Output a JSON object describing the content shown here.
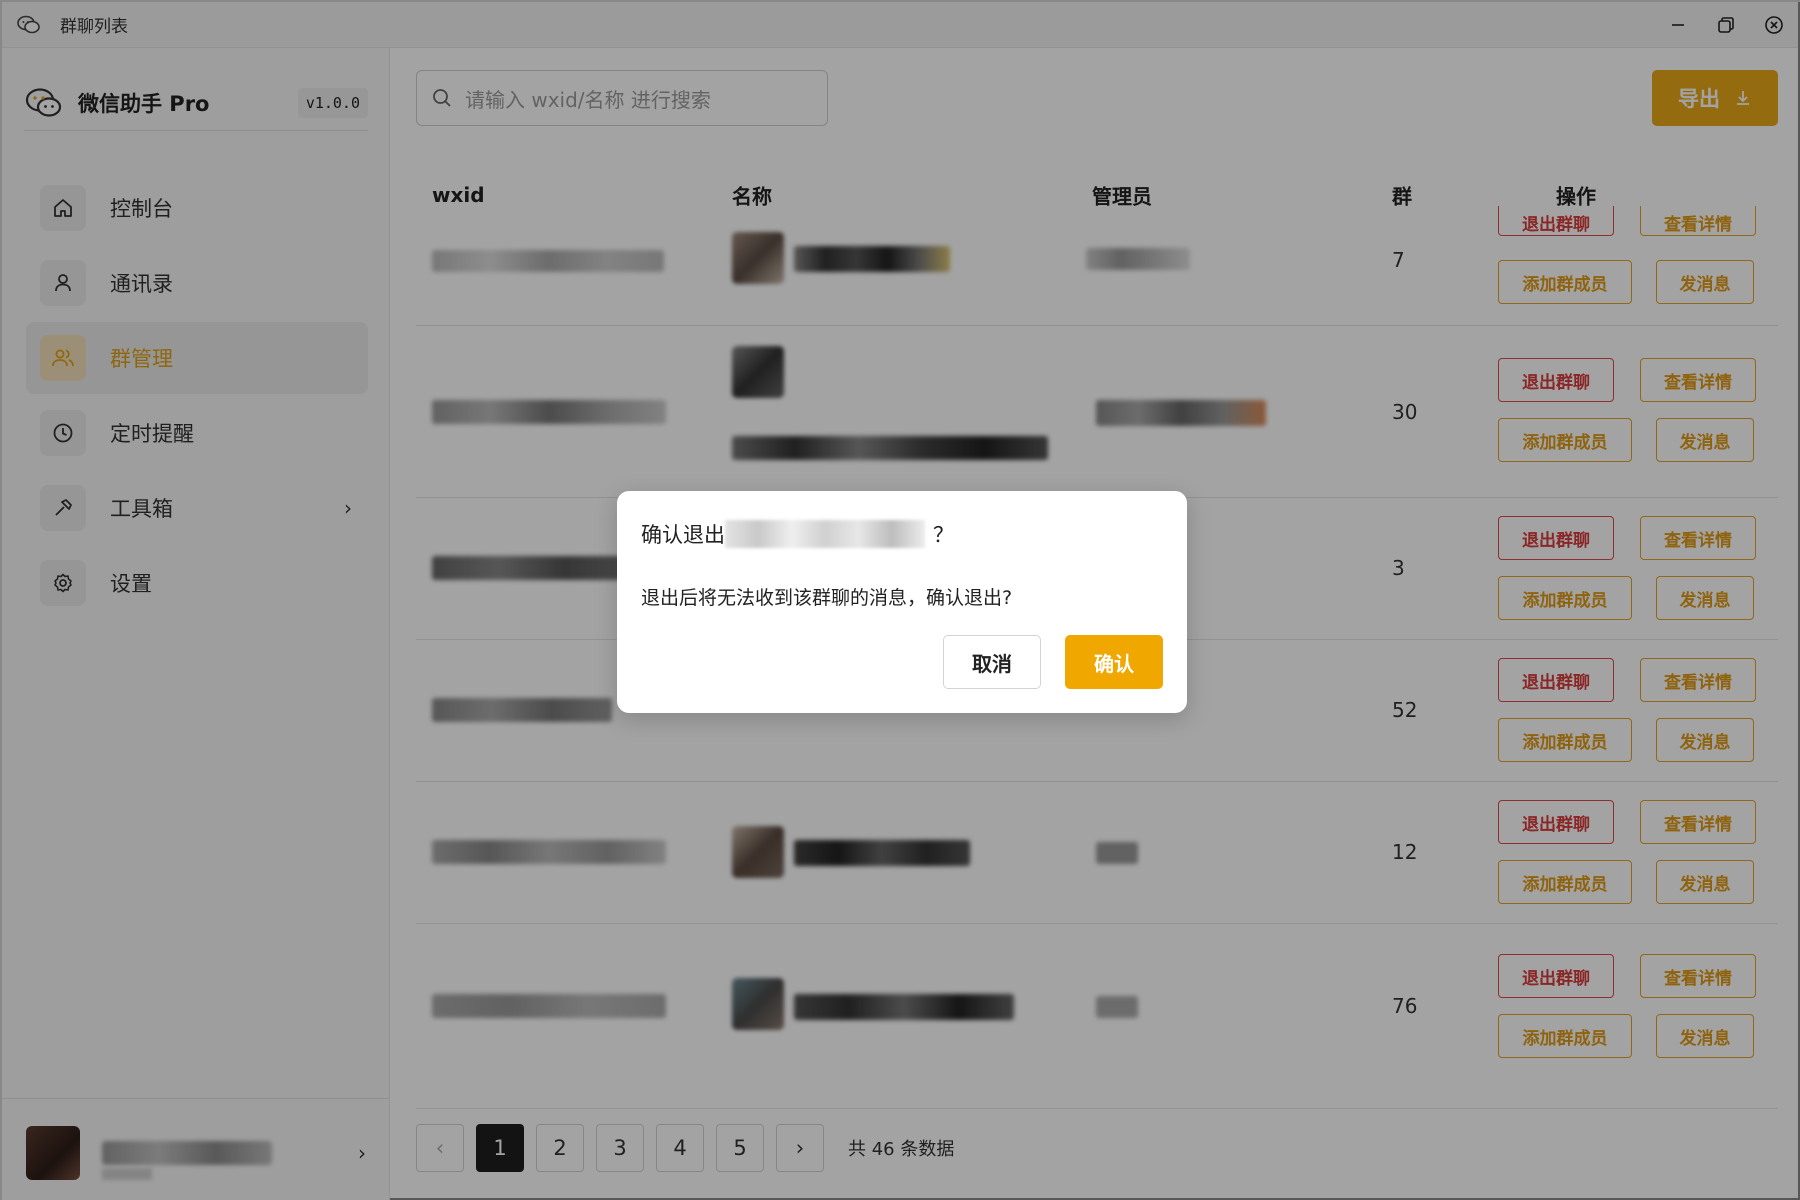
{
  "window": {
    "title": "群聊列表"
  },
  "sidebar": {
    "brand_name": "微信助手 Pro",
    "version": "v1.0.0",
    "items": [
      {
        "label": "控制台",
        "icon": "home-icon"
      },
      {
        "label": "通讯录",
        "icon": "person-icon"
      },
      {
        "label": "群管理",
        "icon": "group-icon",
        "active": true
      },
      {
        "label": "定时提醒",
        "icon": "clock-icon"
      },
      {
        "label": "工具箱",
        "icon": "hammer-icon",
        "has_submenu": true
      },
      {
        "label": "设置",
        "icon": "gear-icon"
      }
    ]
  },
  "toolbar": {
    "search_placeholder": "请输入 wxid/名称 进行搜索",
    "export_label": "导出"
  },
  "table": {
    "columns": [
      "wxid",
      "名称",
      "管理员",
      "群",
      "操作"
    ],
    "rows": [
      {
        "member_count": "7"
      },
      {
        "member_count": "30"
      },
      {
        "member_count": "3"
      },
      {
        "member_count": "52"
      },
      {
        "member_count": "12"
      },
      {
        "member_count": "76"
      }
    ],
    "actions": {
      "quit": "退出群聊",
      "detail": "查看详情",
      "add_member": "添加群成员",
      "send_msg": "发消息"
    }
  },
  "pagination": {
    "pages": [
      "1",
      "2",
      "3",
      "4",
      "5"
    ],
    "current": "1",
    "total_text": "共 46 条数据"
  },
  "dialog": {
    "title_prefix": "确认退出",
    "title_suffix": "？",
    "body": "退出后将无法收到该群聊的消息，确认退出?",
    "cancel_label": "取消",
    "confirm_label": "确认"
  },
  "colors": {
    "accent": "#e9a81a",
    "danger": "#d93c3c",
    "active_page": "#1f1f1f"
  }
}
